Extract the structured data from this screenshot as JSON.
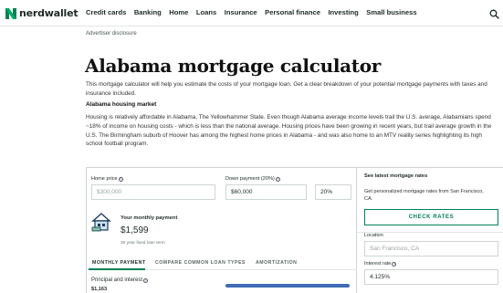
{
  "header": {
    "logo_text": "nerdwallet",
    "nav": [
      "Credit cards",
      "Banking",
      "Home",
      "Loans",
      "Insurance",
      "Personal finance",
      "Investing",
      "Small business"
    ],
    "search_icon": "search-icon",
    "brand_color": "#008254"
  },
  "page": {
    "disclosure": "Advertiser disclosure",
    "title": "Alabama mortgage calculator",
    "intro": "This mortgage calculator will help you estimate the costs of your mortgage loan. Get a clear breakdown of your potential mortgage payments with taxes and insurance included.",
    "section_heading": "Alabama housing market",
    "housing_text": "Housing is relatively affordable in Alabama, The Yellowhammer State. Even though Alabama average income levels trail the U.S. average, Alabamians spend ~18% of income on housing costs - which is less than the national average. Housing prices have been growing in recent years, but trail average growth in the U.S. The Birmingham suburb of Hoover has among the highest home prices in Alabama - and was also home to an MTV reality series highlighting its high school football program."
  },
  "calculator": {
    "home_price_label": "Home price",
    "home_price_placeholder": "$300,000",
    "down_payment_label": "Down payment (20%)",
    "down_payment_value": "$60,000",
    "down_payment_percent": "20%",
    "monthly_label": "Your monthly payment",
    "monthly_value": "$1,599",
    "loan_term": "30 year fixed loan term",
    "tabs": [
      "MONTHLY PAYMENT",
      "COMPARE COMMON LOAN TYPES",
      "AMORTIZATION"
    ],
    "active_tab": "MONTHLY PAYMENT",
    "principal_label": "Principal and interest",
    "principal_value": "$1,163",
    "bar_color": "#3f6cb5"
  },
  "side": {
    "title": "See latest mortgage rates",
    "description": "Get personalized mortgage rates from San Francisco, CA.",
    "check_button": "CHECK RATES",
    "location_label": "Location",
    "location_placeholder": "San Francisco, CA",
    "interest_label": "Interest rate",
    "interest_value": "4.125%"
  }
}
